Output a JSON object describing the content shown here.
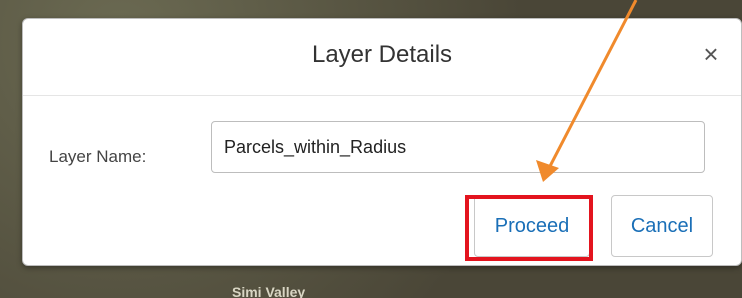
{
  "background": {
    "map_label": "Simi Valley"
  },
  "dialog": {
    "title": "Layer Details",
    "close_symbol": "×",
    "field": {
      "label": "Layer Name:",
      "value": "Parcels_within_Radius"
    },
    "buttons": {
      "proceed_label": "Proceed",
      "cancel_label": "Cancel"
    }
  },
  "annotation": {
    "highlight_color": "#e3141e",
    "arrow_color": "#f08a2c",
    "arrow_target": "proceed-button"
  },
  "colors": {
    "button_text": "#1a6fb7",
    "title_text": "#333333"
  }
}
